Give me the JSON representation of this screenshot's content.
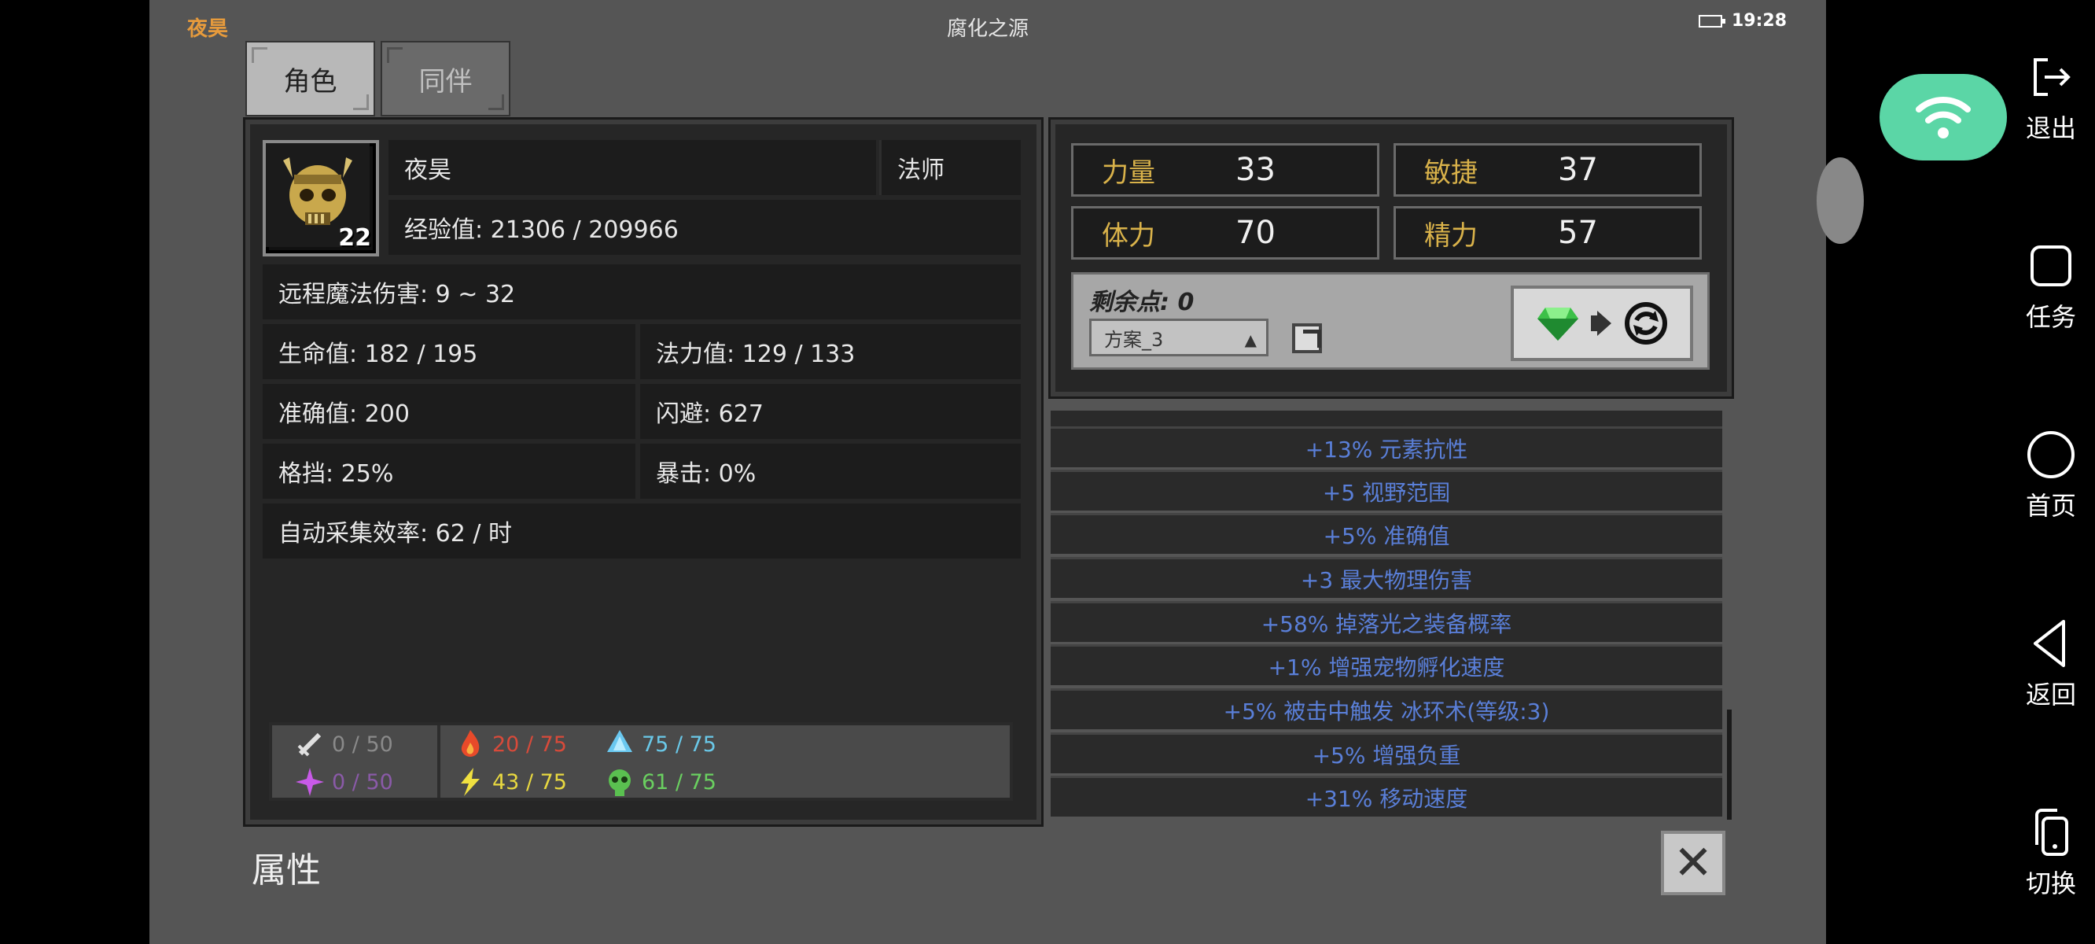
{
  "status_bar": {
    "character_name": "夜昊",
    "app_title": "腐化之源",
    "time": "19:28"
  },
  "tabs": [
    {
      "label": "角色"
    },
    {
      "label": "同伴"
    }
  ],
  "character": {
    "name": "夜昊",
    "class": "法师",
    "level": "22",
    "experience": "经验值: 21306 / 209966",
    "ranged_magic_damage": "远程魔法伤害: 9 ~ 32",
    "hp": "生命值: 182 / 195",
    "mp": "法力值: 129 / 133",
    "accuracy": "准确值: 200",
    "evasion": "闪避: 627",
    "block": "格挡: 25%",
    "crit": "暴击: 0%",
    "auto_gather": "自动采集效率: 62 / 时"
  },
  "resistances": {
    "physical": "0 / 50",
    "fire": "20 / 75",
    "cold": "75 / 75",
    "arcane": "0 / 50",
    "lightning": "43 / 75",
    "poison": "61 / 75",
    "colors": {
      "physical": "#8a8a8a",
      "fire": "#d84a3a",
      "cold": "#6ac8e8",
      "arcane": "#8a5aa8",
      "lightning": "#e8d840",
      "poison": "#6ad060"
    }
  },
  "attributes": [
    {
      "name": "力量",
      "value": "33"
    },
    {
      "name": "敏捷",
      "value": "37"
    },
    {
      "name": "体力",
      "value": "70"
    },
    {
      "name": "精力",
      "value": "57"
    }
  ],
  "points": {
    "label": "剩余点: 0",
    "scheme": "方案_3"
  },
  "affixes": [
    "+13% 元素抗性",
    "+5 视野范围",
    "+5% 准确值",
    "+3 最大物理伤害",
    "+58% 掉落光之装备概率",
    "+1% 增强宠物孵化速度",
    "+5% 被击中触发 冰环术(等级:3)",
    "+5% 增强负重",
    "+31% 移动速度"
  ],
  "footer": {
    "title": "属性"
  },
  "side_menu": [
    {
      "label": "退出",
      "icon": "exit-icon"
    },
    {
      "label": "任务",
      "icon": "task-icon"
    },
    {
      "label": "首页",
      "icon": "home-icon"
    },
    {
      "label": "返回",
      "icon": "back-icon"
    },
    {
      "label": "切换",
      "icon": "switch-icon"
    }
  ]
}
